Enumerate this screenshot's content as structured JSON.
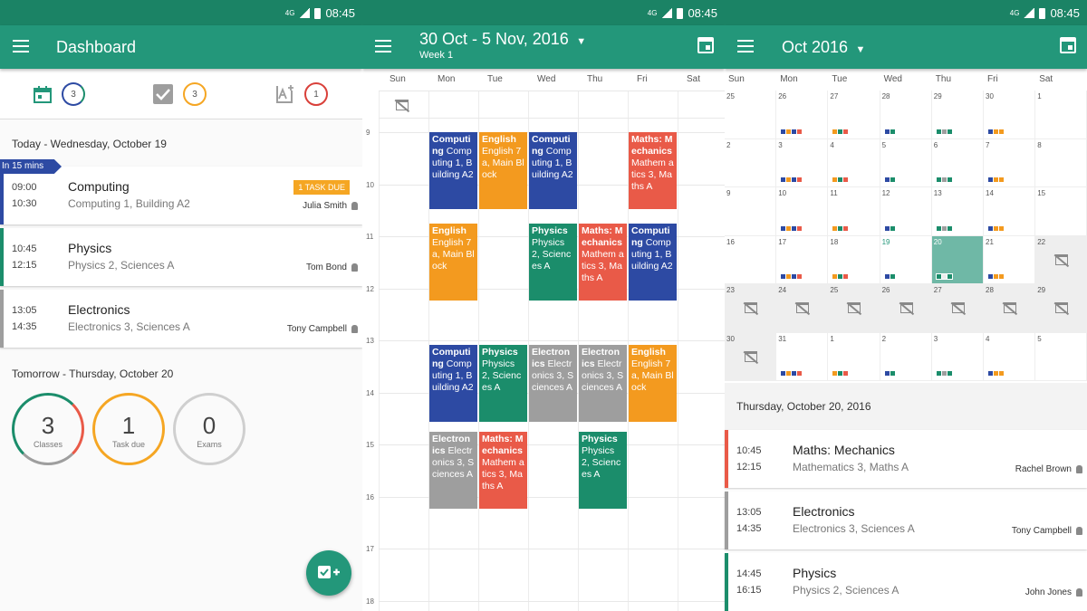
{
  "status": {
    "network": "4G",
    "time": "08:45"
  },
  "colors": {
    "primary": "#23977a",
    "statusbar": "#1b8365",
    "blue": "#2d4aa3",
    "orange": "#f39a1f",
    "green": "#1b8d6b",
    "red": "#e95a48",
    "grey": "#9e9e9e"
  },
  "dashboard": {
    "title": "Dashboard",
    "stats": [
      {
        "icon": "calendar-icon",
        "count": "3"
      },
      {
        "icon": "task-check-icon",
        "count": "3"
      },
      {
        "icon": "exam-grade-icon",
        "count": "1"
      }
    ],
    "today_label": "Today - Wednesday, October 19",
    "soon_flag": "In 15 mins",
    "lessons": [
      {
        "start": "09:00",
        "end": "10:30",
        "subject": "Computing",
        "location": "Computing 1, Building A2",
        "teacher": "Julia Smith",
        "badge": "1 TASK DUE"
      },
      {
        "start": "10:45",
        "end": "12:15",
        "subject": "Physics",
        "location": "Physics 2, Sciences A",
        "teacher": "Tom Bond"
      },
      {
        "start": "13:05",
        "end": "14:35",
        "subject": "Electronics",
        "location": "Electronics 3, Sciences A",
        "teacher": "Tony Campbell"
      }
    ],
    "tomorrow_label": "Tomorrow - Thursday, October 20",
    "rings": [
      {
        "value": "3",
        "label": "Classes"
      },
      {
        "value": "1",
        "label": "Task due"
      },
      {
        "value": "0",
        "label": "Exams"
      }
    ],
    "fab_icon": "add-task-icon"
  },
  "week": {
    "title": "30 Oct - 5 Nov, 2016",
    "subtitle": "Week 1",
    "days": [
      "Sun",
      "Mon",
      "Tue",
      "Wed",
      "Thu",
      "Fri",
      "Sat"
    ],
    "hours": [
      "9",
      "10",
      "11",
      "12",
      "13",
      "14",
      "15",
      "16",
      "17",
      "18"
    ],
    "events": [
      {
        "day": 1,
        "start": 9.0,
        "end": 10.5,
        "color": "blue",
        "title": "Computi ng",
        "detail": "Comp uting 1, Building A2"
      },
      {
        "day": 2,
        "start": 9.0,
        "end": 10.5,
        "color": "orange",
        "title": "English",
        "detail": "English 7a, Main Block"
      },
      {
        "day": 3,
        "start": 9.0,
        "end": 10.5,
        "color": "blue",
        "title": "Computi ng",
        "detail": "Comp uting 1, Building A2"
      },
      {
        "day": 5,
        "start": 9.0,
        "end": 10.5,
        "color": "red",
        "title": "Maths: M echanics",
        "detail": "Mathem atics 3, Maths A"
      },
      {
        "day": 1,
        "start": 10.75,
        "end": 12.25,
        "color": "orange",
        "title": "English",
        "detail": "English 7a, Main Block"
      },
      {
        "day": 3,
        "start": 10.75,
        "end": 12.25,
        "color": "green",
        "title": "Physics",
        "detail": "Physics 2, Sciences A"
      },
      {
        "day": 4,
        "start": 10.75,
        "end": 12.25,
        "color": "red",
        "title": "Maths: M echanics",
        "detail": "Mathem atics 3, Maths A"
      },
      {
        "day": 5,
        "start": 10.75,
        "end": 12.25,
        "color": "blue",
        "title": "Computi ng",
        "detail": "Comp uting 1, Building A2"
      },
      {
        "day": 1,
        "start": 13.08,
        "end": 14.58,
        "color": "blue",
        "title": "Computi ng",
        "detail": "Comp uting 1, Building A2"
      },
      {
        "day": 2,
        "start": 13.08,
        "end": 14.58,
        "color": "green",
        "title": "Physics",
        "detail": "Physics 2, Sciences A"
      },
      {
        "day": 3,
        "start": 13.08,
        "end": 14.58,
        "color": "grey",
        "title": "Electron ics",
        "detail": "Electr onics 3, Sciences A"
      },
      {
        "day": 4,
        "start": 13.08,
        "end": 14.58,
        "color": "grey",
        "title": "Electron ics",
        "detail": "Electr onics 3, Sciences A"
      },
      {
        "day": 5,
        "start": 13.08,
        "end": 14.58,
        "color": "orange",
        "title": "English",
        "detail": "English 7a, Main Block"
      },
      {
        "day": 1,
        "start": 14.75,
        "end": 16.25,
        "color": "grey",
        "title": "Electron ics",
        "detail": "Electr onics 3, Sciences A"
      },
      {
        "day": 2,
        "start": 14.75,
        "end": 16.25,
        "color": "red",
        "title": "Maths: M echanics",
        "detail": "Mathem atics 3, Maths A"
      },
      {
        "day": 4,
        "start": 14.75,
        "end": 16.25,
        "color": "green",
        "title": "Physics",
        "detail": "Physics 2, Sciences A"
      }
    ]
  },
  "month": {
    "title": "Oct 2016",
    "days": [
      "Sun",
      "Mon",
      "Tue",
      "Wed",
      "Thu",
      "Fri",
      "Sat"
    ],
    "weeks": [
      [
        "25",
        "26",
        "27",
        "28",
        "29",
        "30",
        "1"
      ],
      [
        "2",
        "3",
        "4",
        "5",
        "6",
        "7",
        "8"
      ],
      [
        "9",
        "10",
        "11",
        "12",
        "13",
        "14",
        "15"
      ],
      [
        "16",
        "17",
        "18",
        "19",
        "20",
        "21",
        "22"
      ],
      [
        "23",
        "24",
        "25",
        "26",
        "27",
        "28",
        "29"
      ],
      [
        "30",
        "31",
        "1",
        "2",
        "3",
        "4",
        "5"
      ]
    ],
    "selected_date": "20",
    "selected_label": "Thursday, October 20, 2016",
    "lessons": [
      {
        "start": "10:45",
        "end": "12:15",
        "subject": "Maths: Mechanics",
        "location": "Mathematics 3, Maths A",
        "teacher": "Rachel Brown"
      },
      {
        "start": "13:05",
        "end": "14:35",
        "subject": "Electronics",
        "location": "Electronics 3, Sciences A",
        "teacher": "Tony Campbell"
      },
      {
        "start": "14:45",
        "end": "16:15",
        "subject": "Physics",
        "location": "Physics 2, Sciences A",
        "teacher": "John Jones"
      }
    ]
  }
}
